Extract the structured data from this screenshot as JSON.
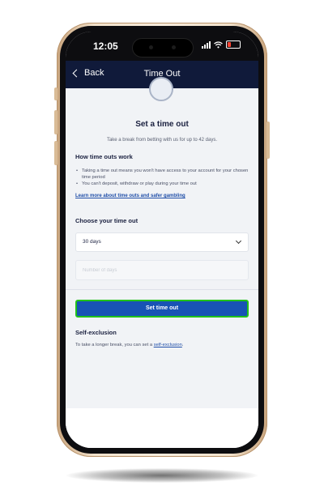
{
  "status_bar": {
    "time": "12:05"
  },
  "header": {
    "back_label": "Back",
    "title": "Time Out"
  },
  "main": {
    "title": "Set a time out",
    "subtitle": "Take a break from betting with us for up to 42 days.",
    "how_heading": "How time outs work",
    "bullets": [
      "Taking a time out means you won't have access to your account for your chosen time period",
      "You can't deposit, withdraw or play during your time out"
    ],
    "learn_more_link": "Learn more about time outs and safer gambling",
    "choose_heading": "Choose your time out",
    "select_value": "30 days",
    "days_placeholder": "Number of days",
    "set_button_label": "Set time out",
    "self_exclusion_heading": "Self-exclusion",
    "self_exclusion_text_prefix": "To take a longer break, you can set a ",
    "self_exclusion_link": "self-exclusion",
    "self_exclusion_text_suffix": "."
  },
  "colors": {
    "header_bg": "#101a3a",
    "primary_button": "#1853b5",
    "button_highlight_border": "#21c21a",
    "link": "#1f4ea8",
    "frame_gold": "#e8d3b6"
  }
}
